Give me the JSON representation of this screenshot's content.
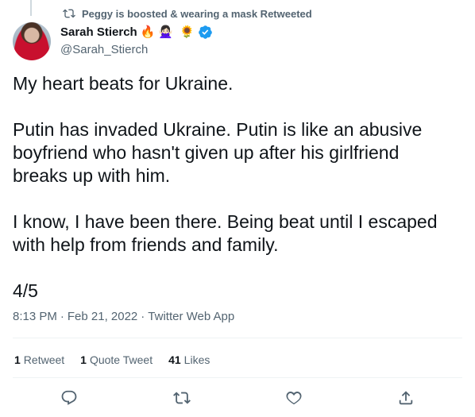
{
  "social_context": {
    "text": "Peggy is boosted & wearing a mask Retweeted"
  },
  "author": {
    "name": "Sarah Stierch",
    "name_emoji": [
      "🔥",
      "🙅🏻‍♀️",
      "🌻"
    ],
    "handle": "@Sarah_Stierch"
  },
  "tweet": {
    "text": "My heart beats for Ukraine.\n\nPutin has invaded Ukraine. Putin is like an abusive boyfriend who hasn't given up after his girlfriend breaks up with him.\n\nI know, I have been there. Being beat until I escaped with help from friends and family.\n\n4/5",
    "time": "8:13 PM",
    "date": "Feb 21, 2022",
    "source": "Twitter Web App",
    "separator": "·"
  },
  "stats": [
    {
      "count": "1",
      "label": "Retweet"
    },
    {
      "count": "1",
      "label": "Quote Tweet"
    },
    {
      "count": "41",
      "label": "Likes"
    }
  ],
  "actions": [
    "reply-icon",
    "retweet-icon",
    "like-icon",
    "share-icon"
  ],
  "colors": {
    "text": "#0f1419",
    "secondary": "#536471",
    "verified": "#1d9bf0",
    "divider": "#eff3f4"
  }
}
